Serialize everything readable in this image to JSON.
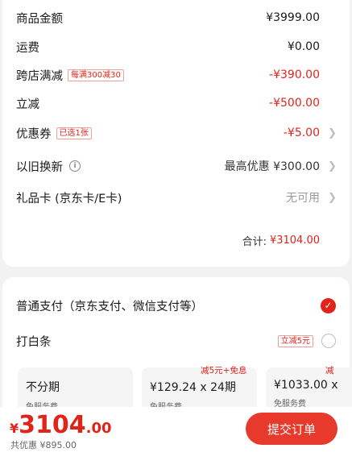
{
  "summary": {
    "rows": [
      {
        "label": "商品金额",
        "value": "¥3999.00"
      },
      {
        "label": "运费",
        "value": "¥0.00"
      },
      {
        "label": "跨店满减",
        "tag": "每满300减30",
        "value": "-¥390.00"
      },
      {
        "label": "立减",
        "value": "-¥500.00"
      },
      {
        "label": "优惠券",
        "tag": "已选1张",
        "value": "-¥5.00"
      },
      {
        "label": "以旧换新",
        "value": "最高优惠 ¥300.00"
      },
      {
        "label": "礼品卡 (京东卡/E卡)",
        "value": "无可用"
      }
    ],
    "total_label": "合计:",
    "total_value": "¥3104.00"
  },
  "payment": {
    "normal_label": "普通支付（京东支付、微信支付等）",
    "baitiao_label": "打白条",
    "baitiao_tag": "立减5元",
    "plans": [
      {
        "main": "不分期",
        "sub": "免服务费",
        "promo": ""
      },
      {
        "main": "¥129.24 x 24期",
        "sub": "免服务费",
        "promo": "减5元+免息"
      },
      {
        "main": "¥1033.00 x",
        "sub": "免服务费",
        "promo": "减"
      }
    ]
  },
  "footer": {
    "currency": "¥",
    "price_int": "3104",
    "price_dec": ".00",
    "saved": "共优惠 ¥895.00",
    "submit_label": "提交订单"
  },
  "colors": {
    "accent": "#e2231a",
    "button": "#e83a2c",
    "background": "#f2f2f2"
  }
}
